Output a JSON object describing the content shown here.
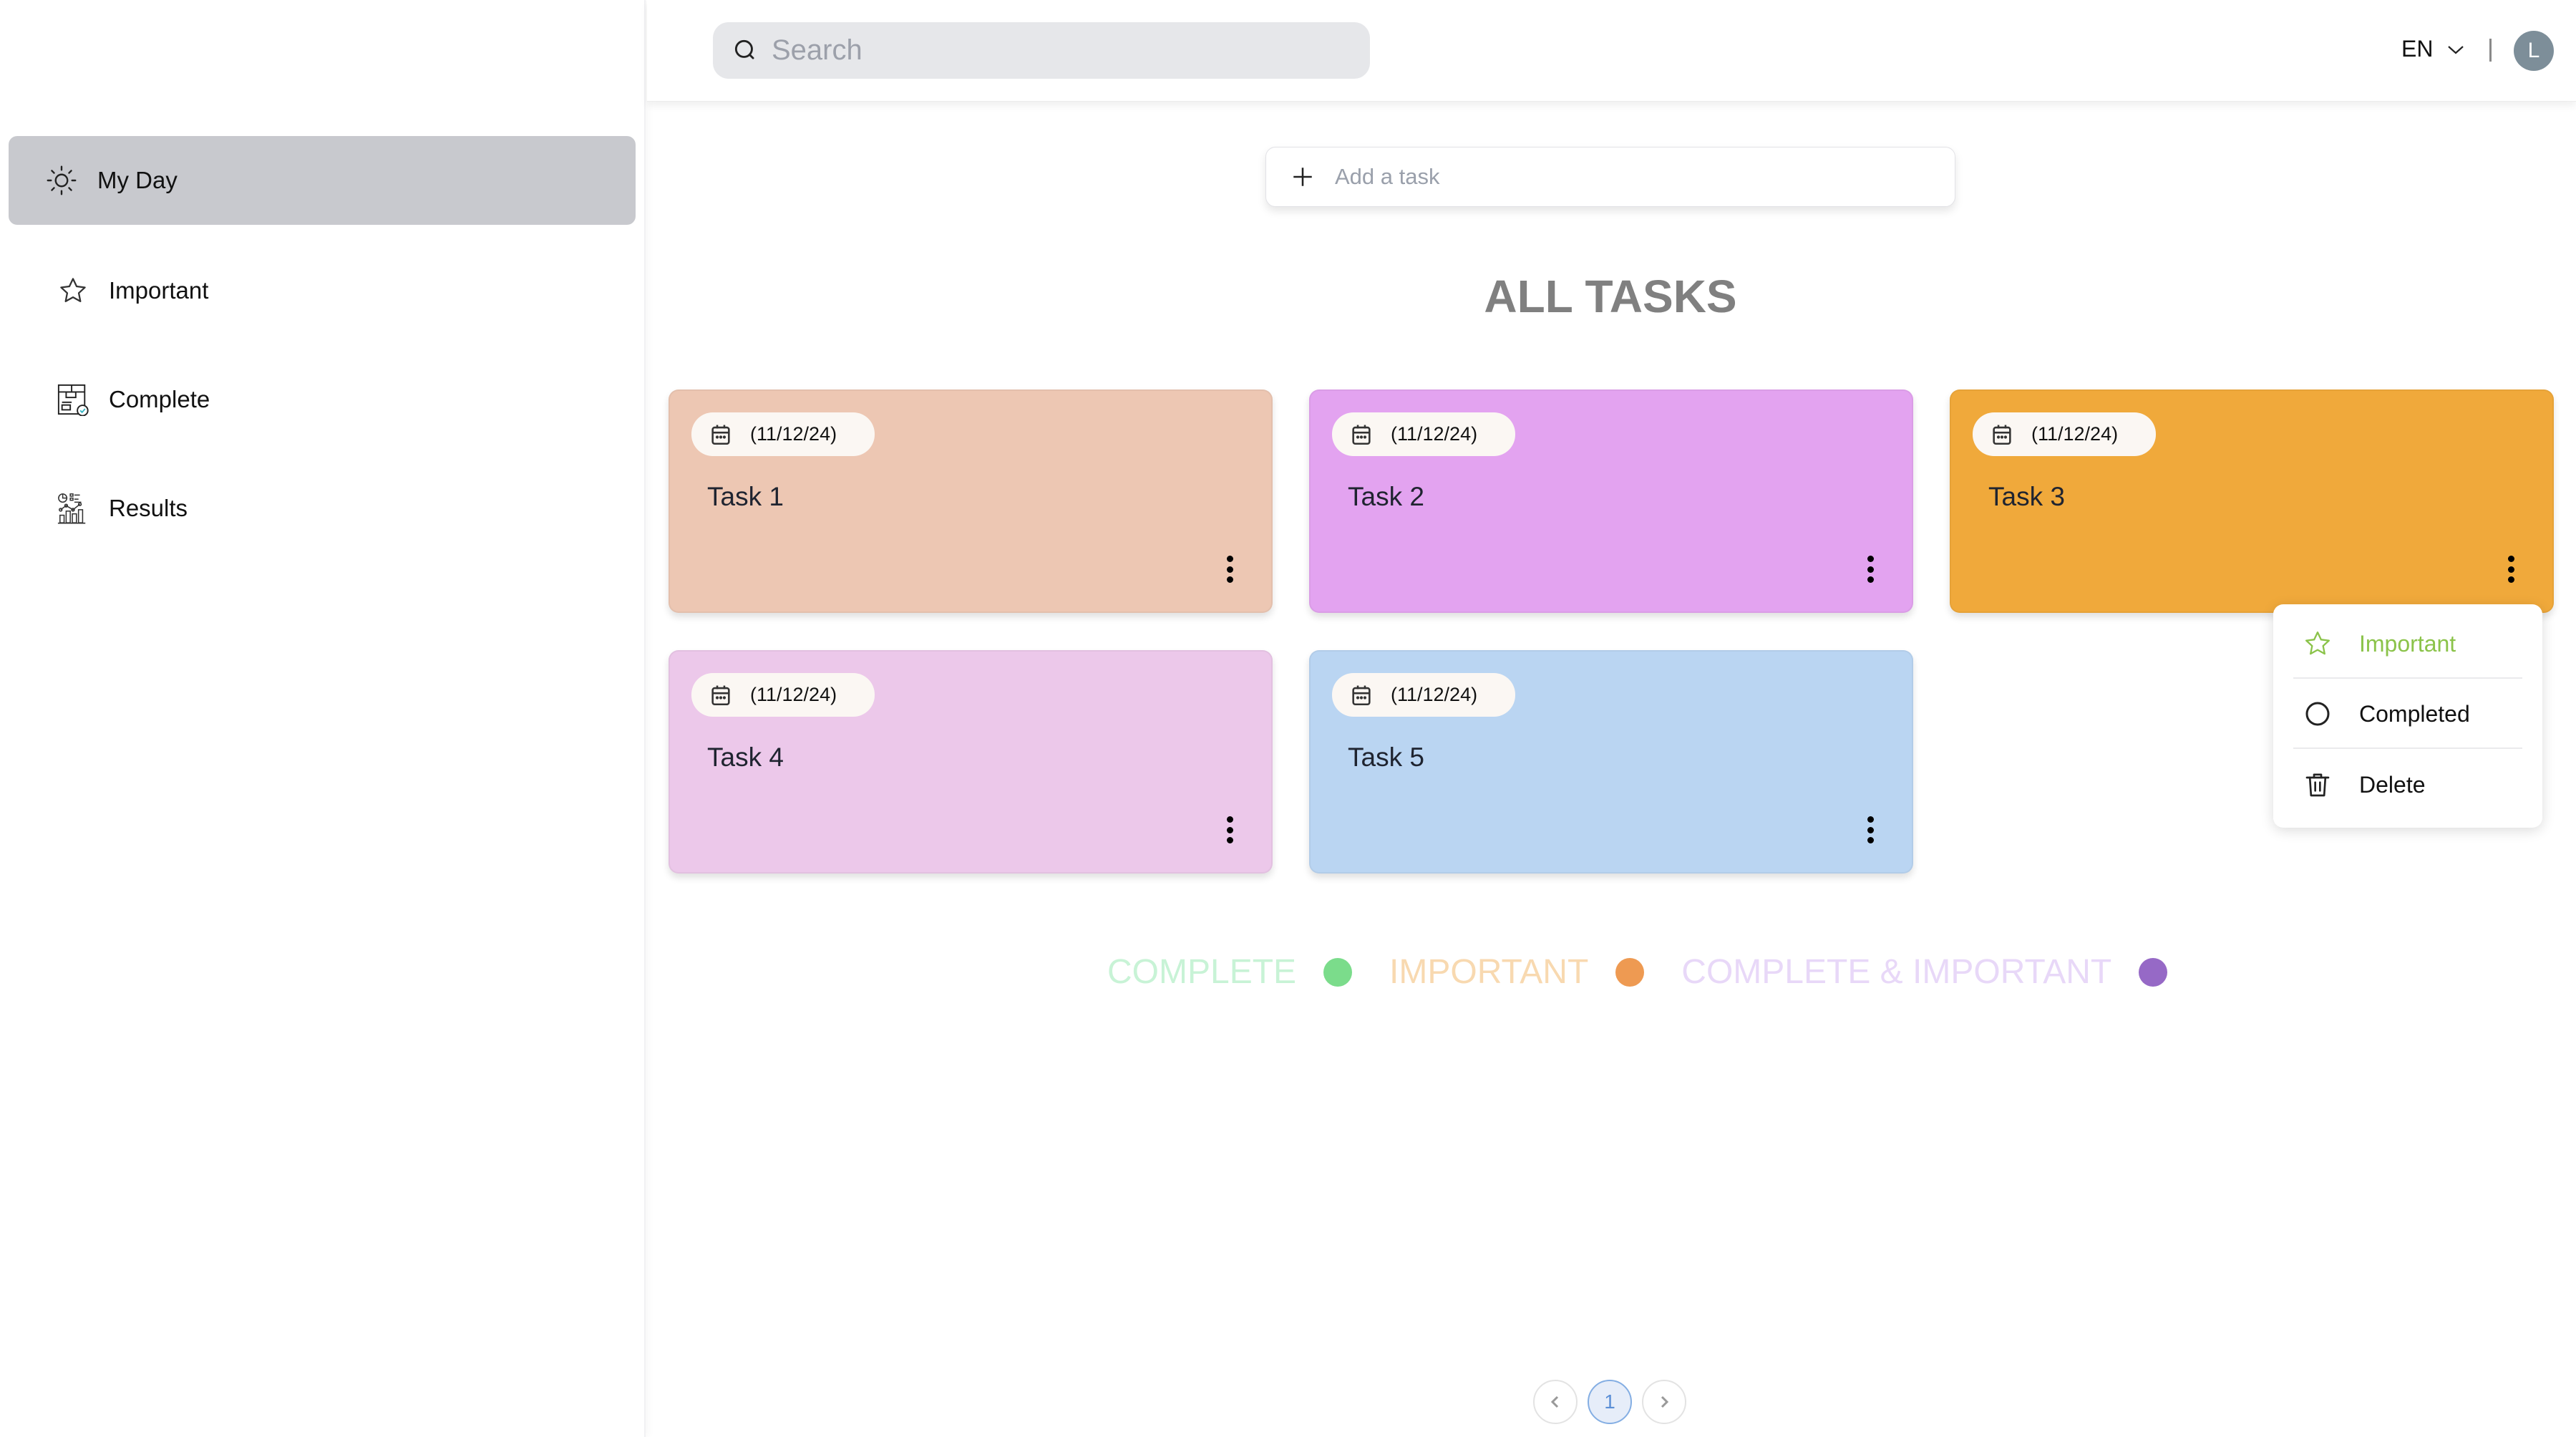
{
  "sidebar": {
    "items": [
      {
        "label": "My Day",
        "icon": "sun-icon",
        "active": true
      },
      {
        "label": "Important",
        "icon": "star-icon",
        "active": false
      },
      {
        "label": "Complete",
        "icon": "complete-box-icon",
        "active": false
      },
      {
        "label": "Results",
        "icon": "analytics-icon",
        "active": false
      }
    ]
  },
  "header": {
    "search_placeholder": "Search",
    "language": "EN",
    "avatar_initial": "L"
  },
  "add_task": {
    "placeholder": "Add a task"
  },
  "main": {
    "title": "ALL TASKS"
  },
  "tasks": [
    {
      "title": "Task 1",
      "date": "(11/12/24)",
      "color": "#edc7b3"
    },
    {
      "title": "Task 2",
      "date": "(11/12/24)",
      "color": "#e3a3f0"
    },
    {
      "title": "Task 3",
      "date": "(11/12/24)",
      "color": "#f0a93b"
    },
    {
      "title": "Task 4",
      "date": "(11/12/24)",
      "color": "#ecc8ea"
    },
    {
      "title": "Task 5",
      "date": "(11/12/24)",
      "color": "#bad5f2"
    }
  ],
  "context_menu": {
    "items": [
      {
        "label": "Important",
        "icon": "star-icon",
        "color": "#8bc34a"
      },
      {
        "label": "Completed",
        "icon": "circle-icon"
      },
      {
        "label": "Delete",
        "icon": "trash-icon"
      }
    ]
  },
  "legend": [
    {
      "label": "COMPLETE",
      "text_color": "#c8f3d6",
      "dot_color": "#7bdc8b"
    },
    {
      "label": "IMPORTANT",
      "text_color": "#f8d9b0",
      "dot_color": "#ee9a52"
    },
    {
      "label": "COMPLETE & IMPORTANT",
      "text_color": "#e8d8f8",
      "dot_color": "#9669c6"
    }
  ],
  "pagination": {
    "current_page": "1"
  }
}
